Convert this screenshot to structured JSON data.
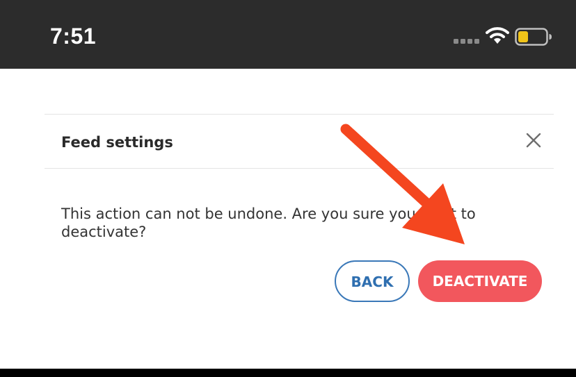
{
  "status_bar": {
    "time": "7:51",
    "icons": [
      "cellular-signal-icon",
      "wifi-icon",
      "battery-low-icon"
    ],
    "battery_color": "#f0c419"
  },
  "dialog": {
    "title": "Feed settings",
    "message": "This action can not be undone. Are you sure you want to deactivate?",
    "close_icon": "close-icon",
    "back_label": "BACK",
    "deactivate_label": "DEACTIVATE"
  },
  "colors": {
    "accent_blue": "#2f6fb0",
    "danger": "#f2575d",
    "annotation_arrow": "#f4461f"
  }
}
